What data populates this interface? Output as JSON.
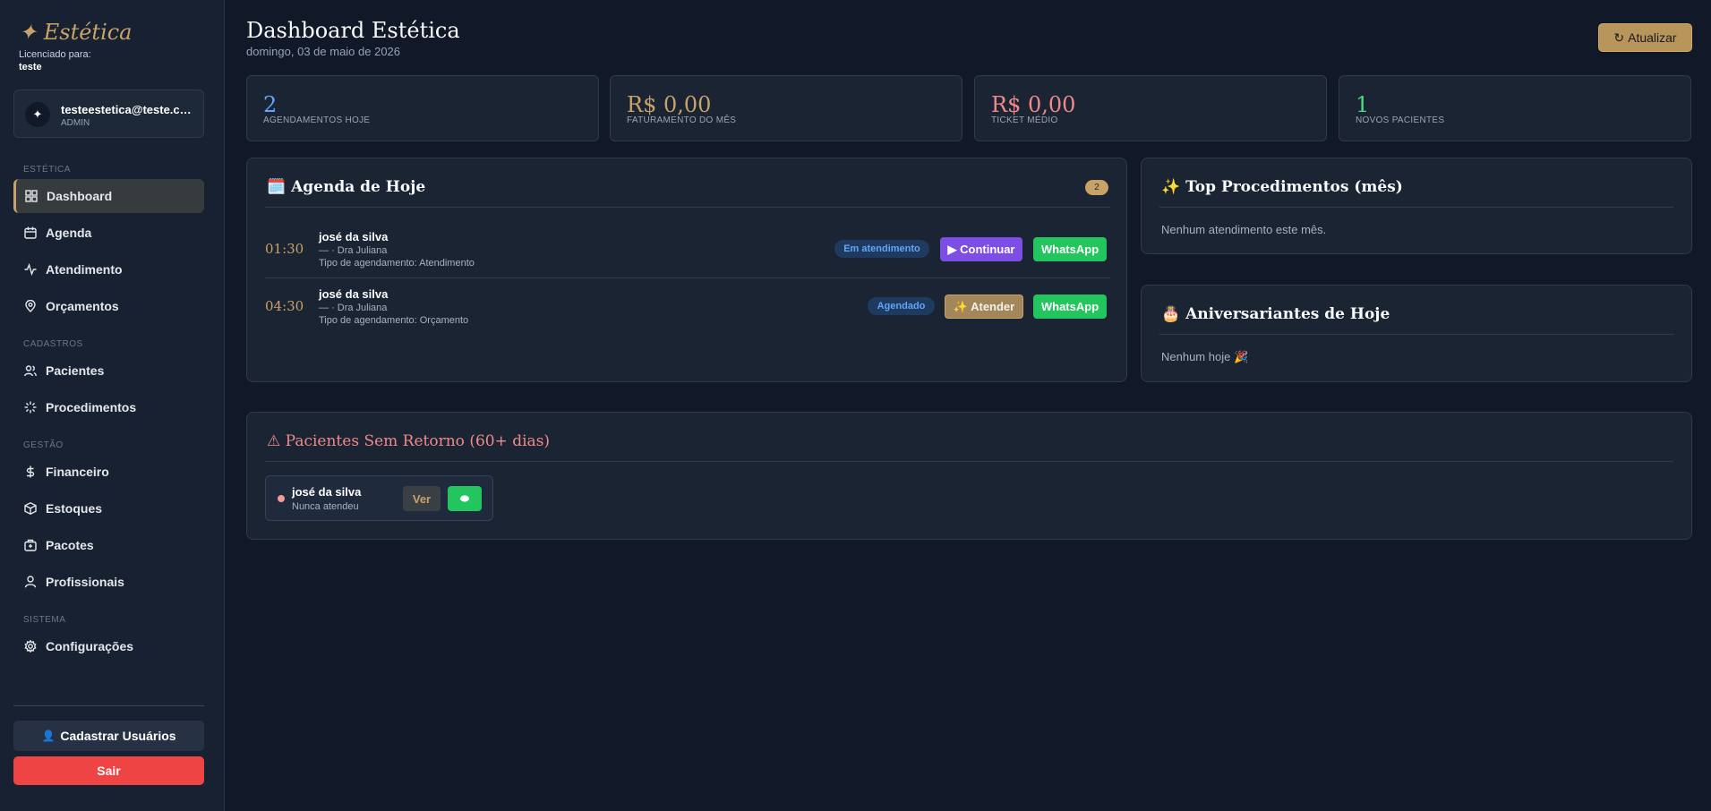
{
  "sidebar": {
    "brand": "✦ Estética",
    "licensed_label": "Licenciado para:",
    "licensed_to": "teste",
    "user": {
      "avatar": "✦",
      "email": "testeestetica@teste.com",
      "role": "ADMIN"
    },
    "sections": {
      "estetica": "ESTÉTICA",
      "cadastros": "CADASTROS",
      "gestao": "GESTÃO",
      "sistema": "SISTEMA"
    },
    "items": [
      {
        "label": "Dashboard",
        "icon": "grid-icon",
        "active": true
      },
      {
        "label": "Agenda",
        "icon": "calendar-icon"
      },
      {
        "label": "Atendimento",
        "icon": "activity-icon"
      },
      {
        "label": "Orçamentos",
        "icon": "map-pin-icon"
      },
      {
        "label": "Pacientes",
        "icon": "users-icon"
      },
      {
        "label": "Procedimentos",
        "icon": "sparkle-icon"
      },
      {
        "label": "Financeiro",
        "icon": "dollar-icon"
      },
      {
        "label": "Estoques",
        "icon": "box-icon"
      },
      {
        "label": "Pacotes",
        "icon": "package-icon"
      },
      {
        "label": "Profissionais",
        "icon": "user-icon"
      },
      {
        "label": "Configurações",
        "icon": "gear-icon"
      }
    ],
    "register_users": "Cadastrar Usuários",
    "register_icon": "👤",
    "logout": "Sair"
  },
  "header": {
    "title": "Dashboard Estética",
    "date": "domingo, 03 de maio de 2026",
    "refresh_label": "Atualizar",
    "refresh_icon": "↻"
  },
  "stats": [
    {
      "value": "2",
      "label": "AGENDAMENTOS HOJE",
      "color": "#60a5fa"
    },
    {
      "value": "R$ 0,00",
      "label": "FATURAMENTO DO MÊS",
      "color": "#c9a267"
    },
    {
      "value": "R$ 0,00",
      "label": "TICKET MÉDIO",
      "color": "#f08a8a"
    },
    {
      "value": "1",
      "label": "NOVOS PACIENTES",
      "color": "#4ade80"
    }
  ],
  "agenda": {
    "icon": "🗓️",
    "title": "Agenda de Hoje",
    "count": "2",
    "appointments": [
      {
        "time": "01:30",
        "name": "josé da silva",
        "professional": "— · Dra Juliana",
        "type": "Tipo de agendamento: Atendimento",
        "status": "Em atendimento",
        "action": "▶ Continuar",
        "whatsapp": "WhatsApp"
      },
      {
        "time": "04:30",
        "name": "josé da silva",
        "professional": "— · Dra Juliana",
        "type": "Tipo de agendamento: Orçamento",
        "status": "Agendado",
        "action": "✨ Atender",
        "whatsapp": "WhatsApp"
      }
    ]
  },
  "top_procedures": {
    "icon": "✨",
    "title": "Top Procedimentos (mês)",
    "empty": "Nenhum atendimento este mês."
  },
  "birthdays": {
    "icon": "🎂",
    "title": "Aniversariantes de Hoje",
    "empty": "Nenhum hoje 🎉"
  },
  "no_return": {
    "icon": "⚠",
    "title": "Pacientes Sem Retorno (60+ dias)",
    "patients": [
      {
        "name": "josé da silva",
        "note": "Nunca atendeu",
        "view_label": "Ver"
      }
    ]
  }
}
